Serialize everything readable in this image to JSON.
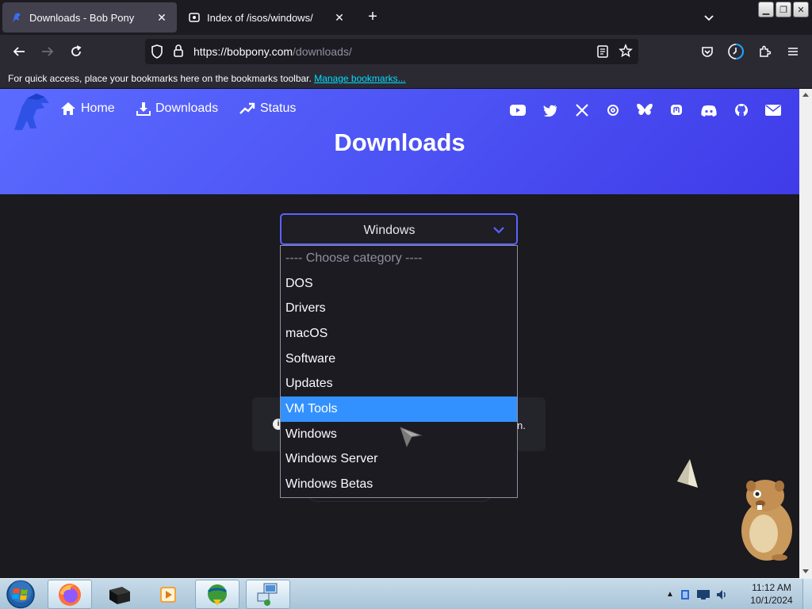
{
  "browser": {
    "tabs": [
      {
        "title": "Downloads - Bob Pony",
        "active": true
      },
      {
        "title": "Index of /isos/windows/",
        "active": false
      }
    ],
    "url": {
      "prefix": "https://bobpony.com",
      "path": "/downloads/"
    },
    "bookmarks_bar": {
      "message": "For quick access, place your bookmarks here on the bookmarks toolbar.",
      "link": "Manage bookmarks..."
    }
  },
  "site": {
    "nav": [
      {
        "label": "Home",
        "icon": "home-icon"
      },
      {
        "label": "Downloads",
        "icon": "download-icon"
      },
      {
        "label": "Status",
        "icon": "trending-up-icon"
      }
    ],
    "social_icons": [
      "youtube-icon",
      "twitter-icon",
      "x-icon",
      "threads-icon",
      "bluesky-icon",
      "mastodon-icon",
      "discord-icon",
      "github-icon",
      "email-icon"
    ],
    "heading": "Downloads",
    "category_select": {
      "value": "Windows",
      "options": [
        {
          "label": "---- Choose category ----",
          "placeholder": true
        },
        {
          "label": "DOS"
        },
        {
          "label": "Drivers"
        },
        {
          "label": "macOS"
        },
        {
          "label": "Software"
        },
        {
          "label": "Updates"
        },
        {
          "label": "VM Tools",
          "highlighted": true
        },
        {
          "label": "Windows"
        },
        {
          "label": "Windows Server"
        },
        {
          "label": "Windows Betas"
        }
      ]
    },
    "obscured_notice_tail": "n."
  },
  "taskbar": {
    "clock_time": "11:12 AM",
    "clock_date": "10/1/2024"
  },
  "colors": {
    "accent": "#4a4ff2",
    "highlight": "#3391ff",
    "page_bg": "#1a1a1f",
    "link": "#00ddff"
  }
}
